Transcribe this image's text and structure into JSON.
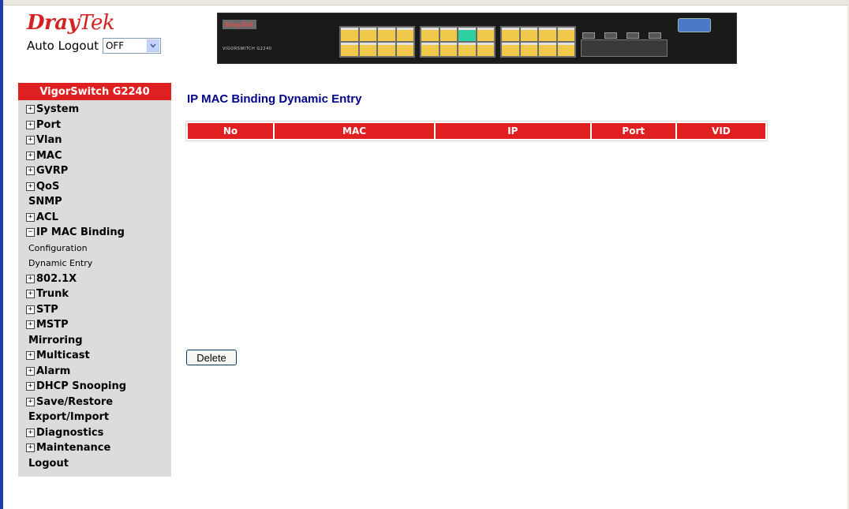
{
  "brand": {
    "name_part1": "Dray",
    "name_part2": "Tek"
  },
  "auto_logout": {
    "label": "Auto Logout",
    "value": "OFF"
  },
  "device": {
    "logo": "DrayTek",
    "model": "VIGORSWITCH G2240"
  },
  "sidebar": {
    "title": "VigorSwitch G2240",
    "items": [
      {
        "label": "System",
        "expander": "+"
      },
      {
        "label": "Port",
        "expander": "+"
      },
      {
        "label": "Vlan",
        "expander": "+"
      },
      {
        "label": "MAC",
        "expander": "+"
      },
      {
        "label": "GVRP",
        "expander": "+"
      },
      {
        "label": "QoS",
        "expander": "+"
      },
      {
        "label": "SNMP"
      },
      {
        "label": "ACL",
        "expander": "+"
      },
      {
        "label": "IP MAC Binding",
        "expander": "−"
      },
      {
        "label": "Configuration",
        "sub": true
      },
      {
        "label": "Dynamic Entry",
        "sub": true
      },
      {
        "label": "802.1X",
        "expander": "+"
      },
      {
        "label": "Trunk",
        "expander": "+"
      },
      {
        "label": "STP",
        "expander": "+"
      },
      {
        "label": "MSTP",
        "expander": "+"
      },
      {
        "label": "Mirroring"
      },
      {
        "label": "Multicast",
        "expander": "+"
      },
      {
        "label": "Alarm",
        "expander": "+"
      },
      {
        "label": "DHCP Snooping",
        "expander": "+"
      },
      {
        "label": "Save/Restore",
        "expander": "+"
      },
      {
        "label": "Export/Import"
      },
      {
        "label": "Diagnostics",
        "expander": "+"
      },
      {
        "label": "Maintenance",
        "expander": "+"
      },
      {
        "label": "Logout"
      }
    ]
  },
  "main": {
    "title": "IP MAC Binding Dynamic Entry",
    "table": {
      "columns": [
        "No",
        "MAC",
        "IP",
        "Port",
        "VID"
      ]
    },
    "delete_label": "Delete"
  },
  "colors": {
    "accent_red": "#e02020",
    "title_blue": "#00008b",
    "sidebar_bg": "#dcdcdc"
  }
}
